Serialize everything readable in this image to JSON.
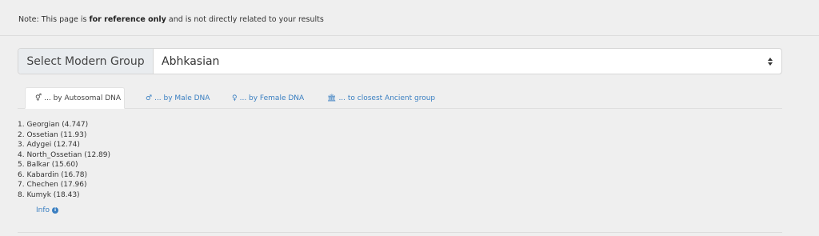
{
  "note": {
    "prefix": "Note: This page is ",
    "bold": "for reference only",
    "suffix": " and is not directly related to your results"
  },
  "select": {
    "label": "Select Modern Group",
    "value": "Abhkasian",
    "icon": "sort-icon"
  },
  "tabs": [
    {
      "icon": "gender-icon",
      "glyph": "⚥",
      "label": "... by Autosomal DNA",
      "active": true
    },
    {
      "icon": "male-icon",
      "glyph": "♂",
      "label": "... by Male DNA",
      "active": false
    },
    {
      "icon": "female-icon",
      "glyph": "♀",
      "label": "... by Female DNA",
      "active": false
    },
    {
      "icon": "museum-icon",
      "glyph": "🏛",
      "label": "... to closest Ancient group",
      "active": false
    }
  ],
  "results": [
    "1. Georgian (4.747)",
    "2. Ossetian (11.93)",
    "3. Adygei (12.74)",
    "4. North_Ossetian (12.89)",
    "5. Balkar (15.60)",
    "6. Kabardin (16.78)",
    "7. Chechen (17.96)",
    "8. Kumyk (18.43)"
  ],
  "info": {
    "label": "Info",
    "icon": "info-icon"
  },
  "colors": {
    "link": "#3a7fc1",
    "background": "#efefef"
  }
}
